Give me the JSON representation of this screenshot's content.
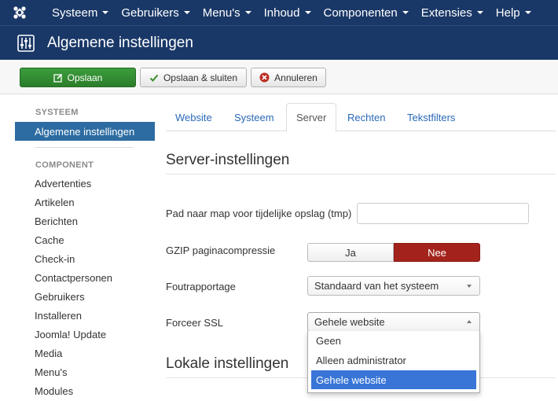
{
  "topnav": {
    "items": [
      "Systeem",
      "Gebruikers",
      "Menu's",
      "Inhoud",
      "Componenten",
      "Extensies",
      "Help"
    ]
  },
  "header": {
    "title": "Algemene instellingen"
  },
  "toolbar": {
    "save_label": "Opslaan",
    "save_close_label": "Opslaan & sluiten",
    "cancel_label": "Annuleren"
  },
  "sidebar": {
    "system_heading": "SYSTEEM",
    "active_item": "Algemene instellingen",
    "component_heading": "COMPONENT",
    "items": [
      "Advertenties",
      "Artikelen",
      "Berichten",
      "Cache",
      "Check-in",
      "Contactpersonen",
      "Gebruikers",
      "Installeren",
      "Joomla! Update",
      "Media",
      "Menu's",
      "Modules"
    ]
  },
  "tabs": [
    "Website",
    "Systeem",
    "Server",
    "Rechten",
    "Tekstfilters"
  ],
  "server": {
    "title": "Server-instellingen",
    "tmp_label": "Pad naar map voor tijdelijke opslag (tmp)",
    "tmp_value": "",
    "gzip_label": "GZIP paginacompressie",
    "gzip_yes": "Ja",
    "gzip_no": "Nee",
    "error_label": "Foutrapportage",
    "error_value": "Standaard van het systeem",
    "ssl_label": "Forceer SSL",
    "ssl_value": "Gehele website",
    "ssl_options": [
      "Geen",
      "Alleen administrator",
      "Gehele website"
    ]
  },
  "locale": {
    "title": "Lokale instellingen"
  },
  "colors": {
    "nav_bg": "#1a3867",
    "save_green": "#2f8a2f",
    "active_blue": "#2d6ca2",
    "nee_red": "#a3231c",
    "option_selected": "#3875d7"
  }
}
